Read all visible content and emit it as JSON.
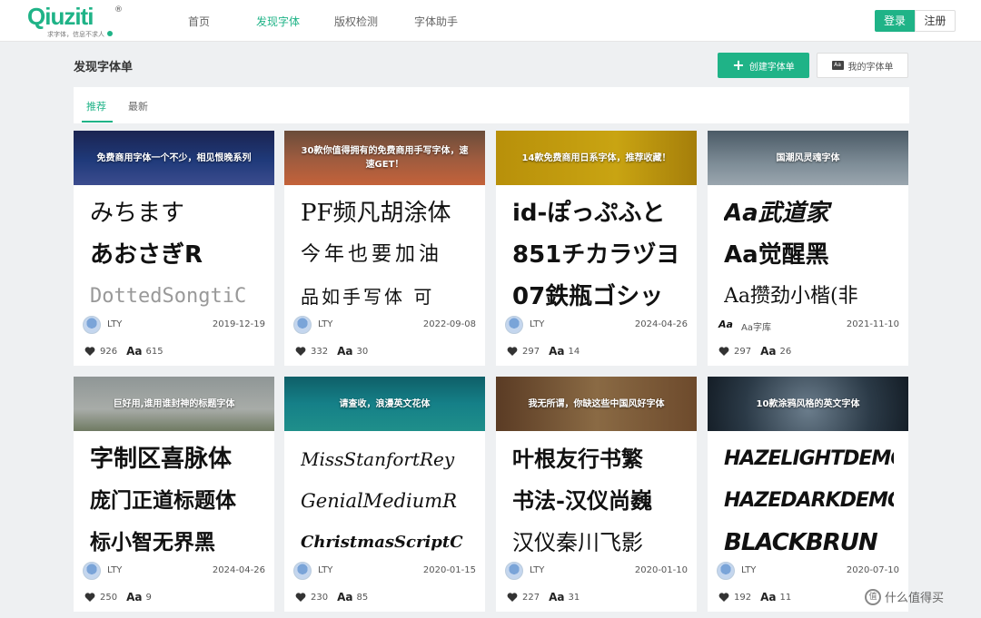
{
  "header": {
    "logo_text": "Qiuziti",
    "logo_reg": "®",
    "logo_slogan": "求字体，信息不求人",
    "nav": [
      "首页",
      "发现字体",
      "版权检测",
      "字体助手"
    ],
    "active_nav": "发现字体",
    "login": "登录",
    "register": "注册",
    "accent_color": "#1fb387"
  },
  "page": {
    "title": "发现字体单",
    "create_button": "创建字体单",
    "my_lists_button": "我的字体单"
  },
  "tabs": [
    "推荐",
    "最新"
  ],
  "cards": [
    {
      "banner": "免费商用字体一个不少，相见恨晚系列",
      "samples": [
        "みちます",
        "あおさぎR",
        "DottedSongtiC"
      ],
      "author": "LTY",
      "date": "2019-12-19",
      "likes": "926",
      "fonts": "615"
    },
    {
      "banner": "30款你值得拥有的免费商用手写字体，速速GET！",
      "samples": [
        "PF频凡胡涂体",
        "今年也要加油",
        "品如手写体 可"
      ],
      "author": "LTY",
      "date": "2022-09-08",
      "likes": "332",
      "fonts": "30"
    },
    {
      "banner": "14款免费商用日系字体，推荐收藏！",
      "samples": [
        "id-ぽっぷふと",
        "851チカラヅヨ",
        "07鉄瓶ゴシッ"
      ],
      "author": "LTY",
      "date": "2024-04-26",
      "likes": "297",
      "fonts": "14"
    },
    {
      "banner": "国潮风灵魂字体",
      "samples": [
        "Aa武道家",
        "Aa觉醒黑",
        "Aa攒劲小楷(非"
      ],
      "author": "Aa字库",
      "date": "2021-11-10",
      "likes": "297",
      "fonts": "26"
    },
    {
      "banner": "巨好用,谁用谁封神的标题字体",
      "samples": [
        "字制区喜脉体",
        "庞门正道标题体",
        "标小智无界黑"
      ],
      "author": "LTY",
      "date": "2024-04-26",
      "likes": "250",
      "fonts": "9"
    },
    {
      "banner": "请查收，浪漫英文花体",
      "samples": [
        "MissStanfortRey",
        "GenialMediumR",
        "ChristmasScriptC"
      ],
      "author": "LTY",
      "date": "2020-01-15",
      "likes": "230",
      "fonts": "85"
    },
    {
      "banner": "我无所谓，你缺这些中国风好字体",
      "samples": [
        "叶根友行书繁",
        "书法-汉仪尚巍",
        "汉仪秦川飞影"
      ],
      "author": "LTY",
      "date": "2020-01-10",
      "likes": "227",
      "fonts": "31"
    },
    {
      "banner": "10款涂鸦风格的英文字体",
      "samples": [
        "HAZELIGHTDEMO",
        "HAZEDARKDEMO",
        "BLACKBRUN"
      ],
      "author": "LTY",
      "date": "2020-07-10",
      "likes": "192",
      "fonts": "11"
    }
  ],
  "watermark": "什么值得买",
  "watermark_icon": "值"
}
